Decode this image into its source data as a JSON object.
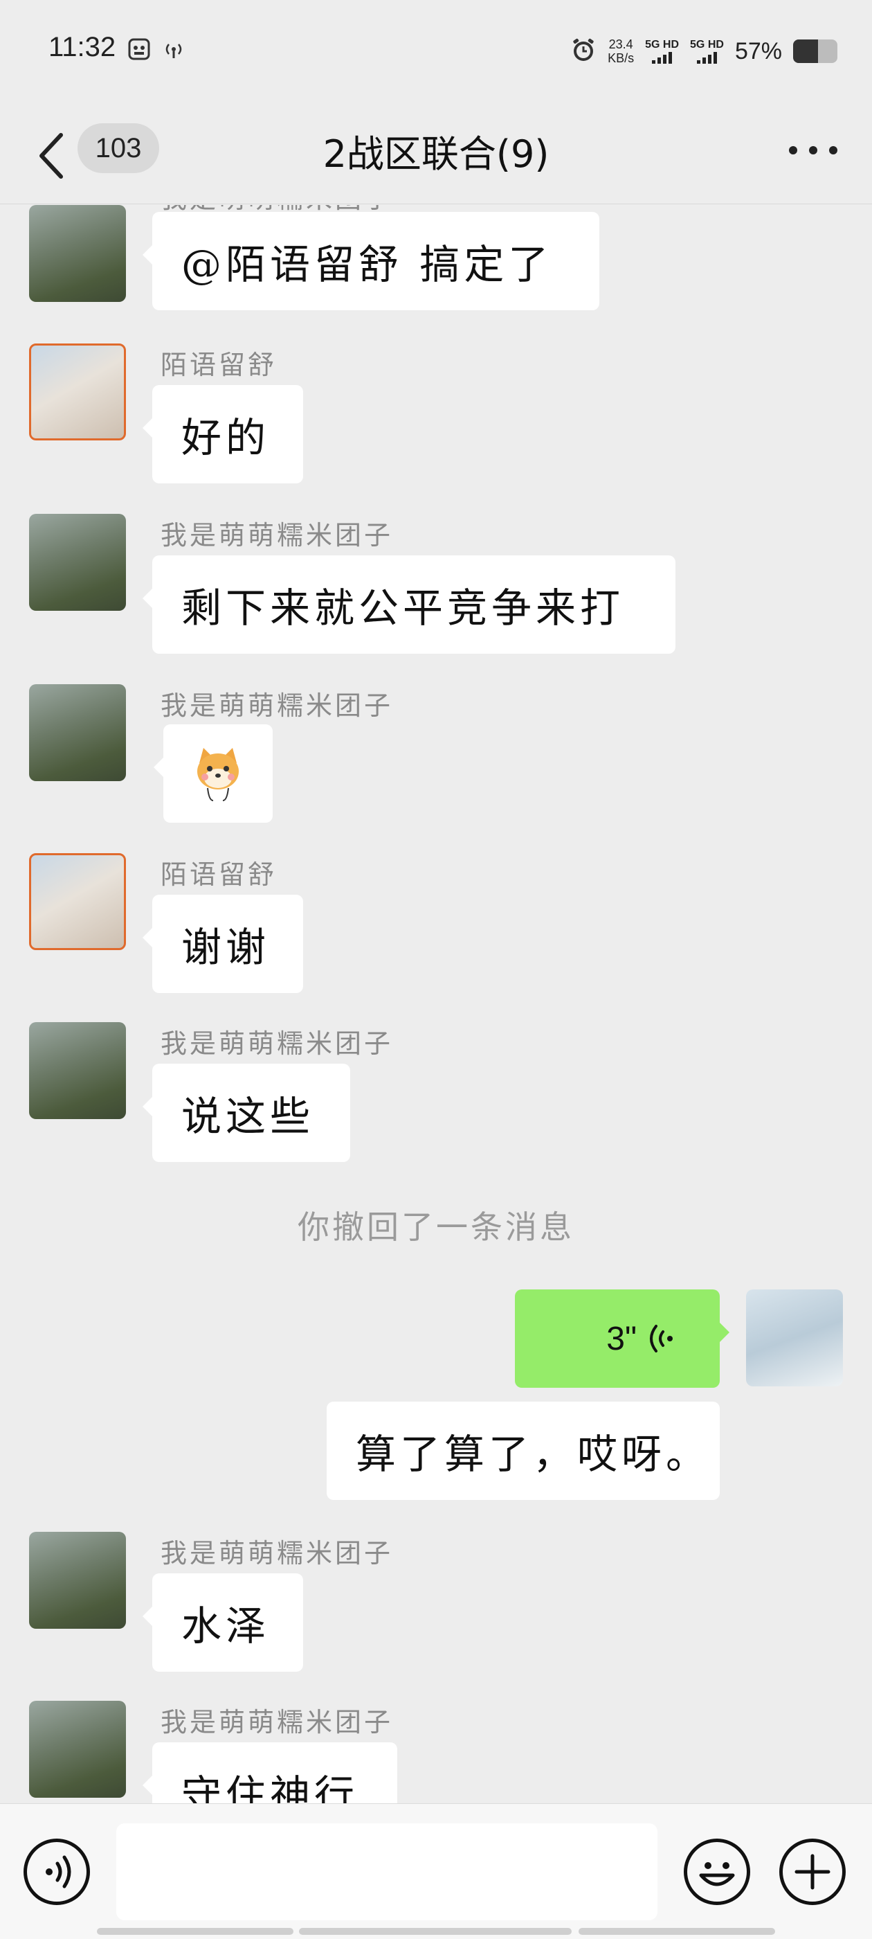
{
  "status_bar": {
    "time": "11:32",
    "net_speed_value": "23.4",
    "net_speed_unit": "KB/s",
    "sim1": "5G HD",
    "sim2": "5G HD",
    "battery_percent_text": "57%",
    "battery_level": 0.57
  },
  "nav": {
    "unread_count": "103",
    "title": "2战区联合(9)"
  },
  "messages": [
    {
      "sender": "我是萌萌糯米团子",
      "text": "@陌语留舒  搞定了"
    },
    {
      "sender": "陌语留舒",
      "text": "好的"
    },
    {
      "sender": "我是萌萌糯米团子",
      "text": "剩下来就公平竞争来打"
    },
    {
      "sender": "我是萌萌糯米团子",
      "sticker": "shiba-dog-sticker"
    },
    {
      "sender": "陌语留舒",
      "text": "谢谢"
    },
    {
      "sender": "我是萌萌糯米团子",
      "text": "说这些"
    },
    {
      "system": "你撤回了一条消息"
    },
    {
      "self": true,
      "voice_duration": "3\""
    },
    {
      "self": true,
      "text": "算了算了，哎呀。"
    },
    {
      "sender": "我是萌萌糯米团子",
      "text": "水泽"
    },
    {
      "sender": "我是萌萌糯米团子",
      "text": "守住神行"
    }
  ],
  "input": {
    "value": "",
    "placeholder": ""
  },
  "colors": {
    "background": "#ededed",
    "bubble_incoming": "#ffffff",
    "bubble_outgoing": "#95ec69"
  },
  "icons": [
    "back-icon",
    "more-icon",
    "voice-mode-icon",
    "emoji-icon",
    "plus-icon",
    "voice-wave-icon"
  ]
}
